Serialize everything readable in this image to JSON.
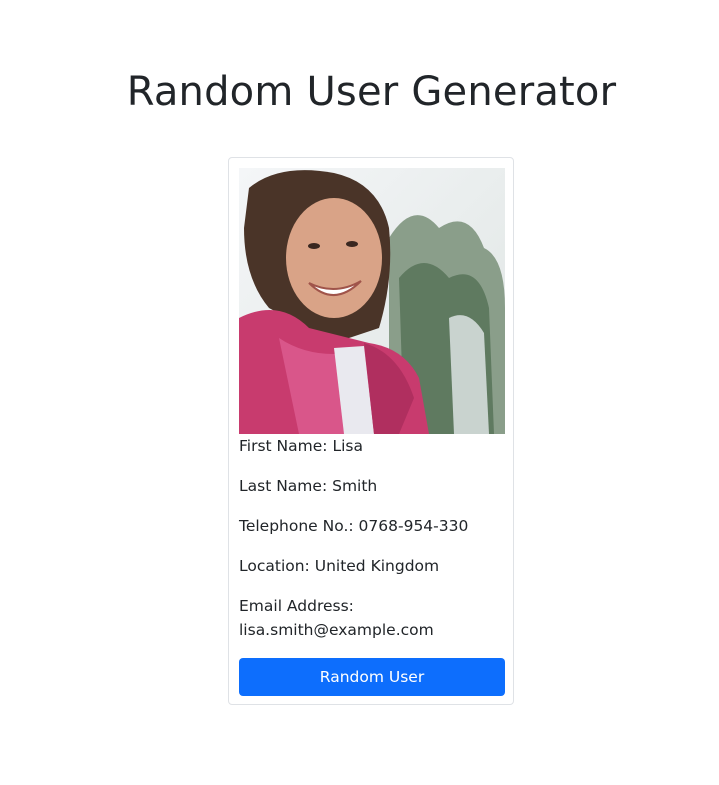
{
  "header": {
    "title": "Random User Generator"
  },
  "user": {
    "photo_alt": "user photo",
    "first_name_label": "First Name:",
    "first_name": "Lisa",
    "last_name_label": "Last Name:",
    "last_name": "Smith",
    "phone_label": "Telephone No.:",
    "phone": "0768-954-330",
    "location_label": "Location:",
    "location": "United Kingdom",
    "email_label": "Email Address:",
    "email": "lisa.smith@example.com"
  },
  "actions": {
    "random_user_label": "Random User"
  },
  "colors": {
    "primary": "#0d6efd",
    "text": "#212529",
    "card_border": "#dfe2e6"
  }
}
